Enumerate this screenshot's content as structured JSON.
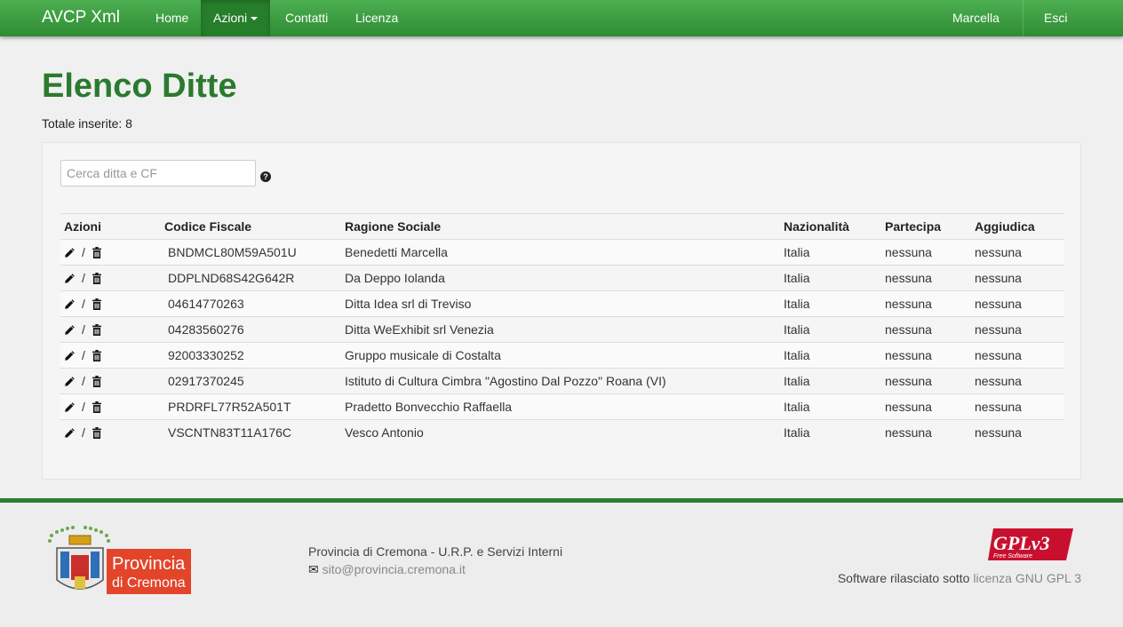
{
  "navbar": {
    "brand": "AVCP Xml",
    "items": [
      {
        "label": "Home"
      },
      {
        "label": "Azioni"
      },
      {
        "label": "Contatti"
      },
      {
        "label": "Licenza"
      }
    ],
    "user": "Marcella",
    "logout": "Esci"
  },
  "page": {
    "title": "Elenco Ditte",
    "total": "Totale inserite: 8"
  },
  "search": {
    "placeholder": "Cerca ditta e CF",
    "value": ""
  },
  "table": {
    "headers": [
      "Azioni",
      "Codice Fiscale",
      "Ragione Sociale",
      "Nazionalità",
      "Partecipa",
      "Aggiudica"
    ],
    "action_separator": "/",
    "rows": [
      {
        "cf": "BNDMCL80M59A501U",
        "name": "Benedetti Marcella",
        "country": "Italia",
        "partecipa": "nessuna",
        "aggiudica": "nessuna"
      },
      {
        "cf": "DDPLND68S42G642R",
        "name": "Da Deppo Iolanda",
        "country": "Italia",
        "partecipa": "nessuna",
        "aggiudica": "nessuna"
      },
      {
        "cf": "04614770263",
        "name": "Ditta Idea srl di Treviso",
        "country": "Italia",
        "partecipa": "nessuna",
        "aggiudica": "nessuna"
      },
      {
        "cf": "04283560276",
        "name": "Ditta WeExhibit srl Venezia",
        "country": "Italia",
        "partecipa": "nessuna",
        "aggiudica": "nessuna"
      },
      {
        "cf": "92003330252",
        "name": "Gruppo musicale di Costalta",
        "country": "Italia",
        "partecipa": "nessuna",
        "aggiudica": "nessuna"
      },
      {
        "cf": "02917370245",
        "name": "Istituto di Cultura Cimbra \"Agostino Dal Pozzo\" Roana (VI)",
        "country": "Italia",
        "partecipa": "nessuna",
        "aggiudica": "nessuna"
      },
      {
        "cf": "PRDRFL77R52A501T",
        "name": "Pradetto Bonvecchio Raffaella",
        "country": "Italia",
        "partecipa": "nessuna",
        "aggiudica": "nessuna"
      },
      {
        "cf": "VSCNTN83T11A176C",
        "name": "Vesco Antonio",
        "country": "Italia",
        "partecipa": "nessuna",
        "aggiudica": "nessuna"
      }
    ]
  },
  "footer": {
    "logo_text_1": "Provincia",
    "logo_text_2": "di Cremona",
    "address": "Provincia di Cremona - U.R.P. e Servizi Interni",
    "email": "sito@provincia.cremona.it",
    "license_prefix": "Software rilasciato sotto",
    "license_link": "licenza GNU GPL 3",
    "gpl_badge": "GPLv3",
    "gpl_sub": "Free Software"
  },
  "colors": {
    "brand_green": "#2b7a2f",
    "navbar_green": "#3d9c41"
  },
  "icons": {
    "edit": "pencil-icon",
    "delete": "trash-icon",
    "help": "question-circle-icon",
    "mail": "envelope-icon"
  }
}
